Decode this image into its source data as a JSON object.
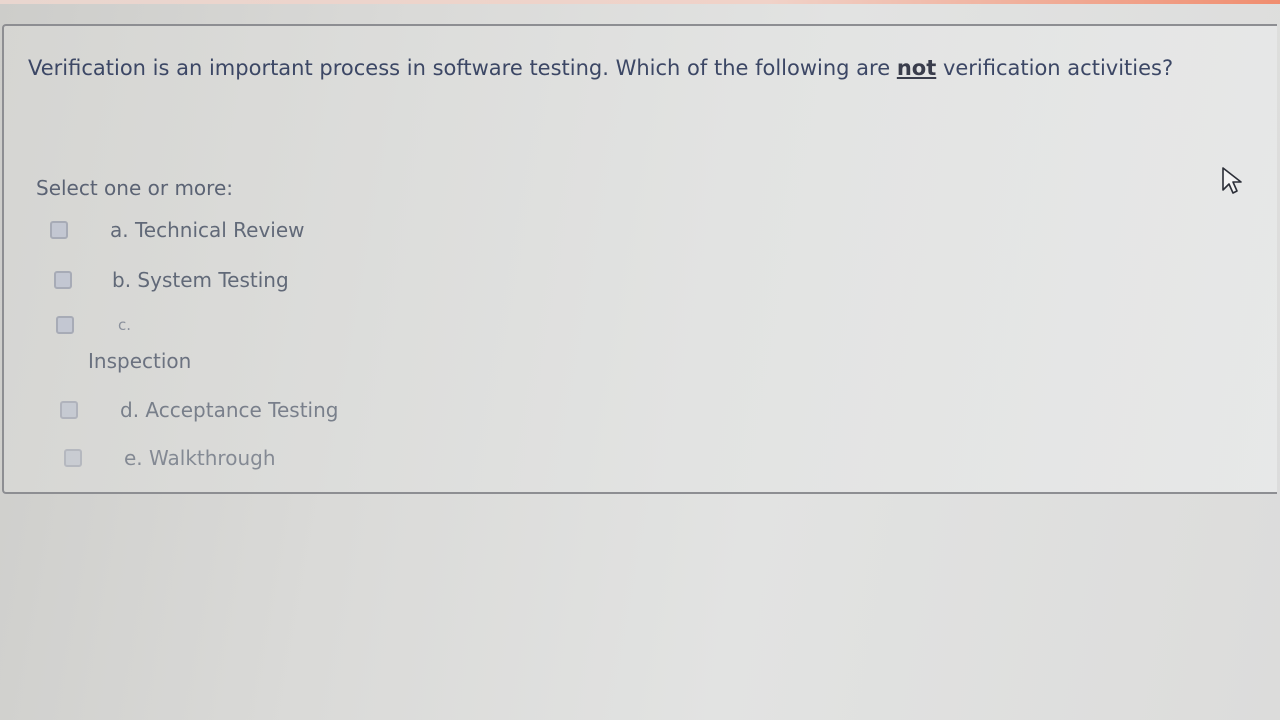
{
  "question": {
    "prefix": "Verification is an important process in software testing. Which of the following are",
    "emphasis": "not",
    "suffix": "verification activities?"
  },
  "select_label": "Select one or more:",
  "options": [
    {
      "label": "a. Technical Review",
      "checked": false
    },
    {
      "label": "b. System Testing",
      "checked": false
    },
    {
      "label": "c.",
      "label_line2": "Inspection",
      "checked": false
    },
    {
      "label": "d. Acceptance Testing",
      "checked": false
    },
    {
      "label": "e. Walkthrough",
      "checked": false
    }
  ],
  "icons": {
    "cursor": "mouse-pointer-icon",
    "checkbox": "checkbox-icon"
  },
  "colors": {
    "question_text": "#3c4765",
    "card_border": "#8d8e92",
    "accent": "#f08d6f"
  }
}
